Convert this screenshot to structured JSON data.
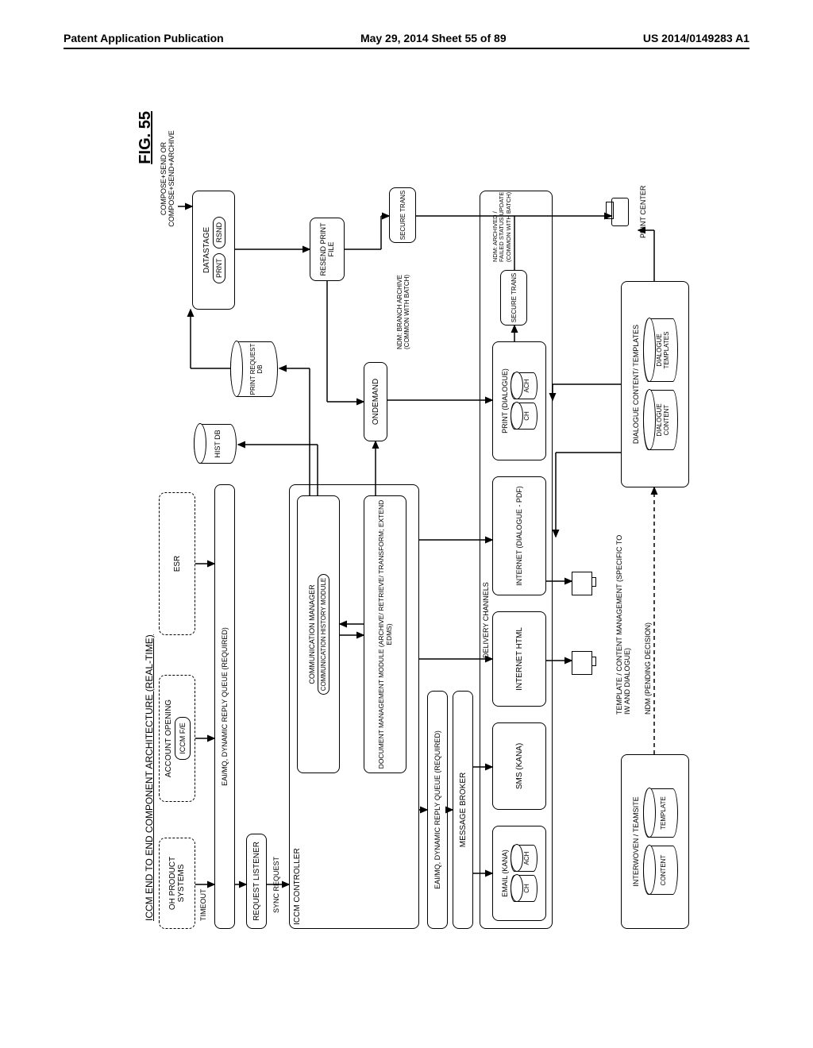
{
  "header": {
    "left": "Patent Application Publication",
    "center": "May 29, 2014  Sheet 55 of 89",
    "right": "US 2014/0149283 A1"
  },
  "figure": {
    "label": "FIG. 55",
    "title": "ICCM END TO END COMPONENT ARCHITECTURE (REAL-TIME)",
    "compose_note": "COMPOSE+SEND OR COMPOSE+SEND+ARCHIVE"
  },
  "boxes": {
    "oh_product_systems": "OH PRODUCT SYSTEMS",
    "account_opening": "ACCOUNT OPENING",
    "iccm_fe": "ICCM F/E",
    "esr": "ESR",
    "timeout": "TIMEOUT",
    "eai_mq_1": "EAI/MQ, DYNAMIC REPLY QUEUE (REQUIRED)",
    "request_listener": "REQUEST LISTENER",
    "sync_request": "SYNC REQUEST",
    "iccm_controller": "ICCM CONTROLLER",
    "comm_manager": "COMMUNICATION MANAGER",
    "comm_history": "COMMUNICATION HISTORY MODULE",
    "hist_db": "HIST DB",
    "print_request_db": "PRINT REQUEST DB",
    "datastage": "DATASTAGE",
    "prnt": "PRNT",
    "rsnd": "RSND",
    "doc_mgmt": "DOCUMENT MANAGEMENT MODULE (ARCHIVE/ RETRIEVE/ TRANSFORM; EXTEND EDMS)",
    "ondemand": "ONDEMAND",
    "resend_print": "RESEND PRINT FILE",
    "eai_mq_2": "EAI/MQ, DYNAMIC REPLY QUEUE (REQUIRED)",
    "message_broker": "MESSAGE BROKER",
    "delivery_channels": "DELIVERY CHANNELS",
    "email_kana": "EMAIL (KANA)",
    "sms_kana": "SMS (KANA)",
    "internet_html": "INTERNET HTML",
    "internet_pdf": "INTERNET (DIALOGUE - PDF)",
    "print_dialogue": "PRINT (DIALOGUE)",
    "ch1": "CH",
    "ach1": "ACH",
    "ch2": "CH",
    "ach2": "ACH",
    "secure_trans_1": "SECURE TRANS",
    "secure_trans_2": "SECURE TRANS",
    "ndm_branch": "NDM: BRANCH ARCHIVE (COMMON WITH BATCH)",
    "ndm_archived": "NDM: ARCHIVED / FAILED STATUS UPDATE (COMMON WITH BATCH)",
    "interwoven": "INTERWOVEN / TEAMSITE",
    "content": "CONTENT",
    "template": "TEMPLATE",
    "template_content_mgmt": "TEMPLATE / CONTENT MANAGEMENT (SPECIFIC TO IW AND DIALOGUE)",
    "ndm_pending": "NDM (PENDING DECISION)",
    "dialogue_ct": "DIALOGUE CONTENT/ TEMPLATES",
    "dialogue_content": "DIALOGUE CONTENT",
    "dialogue_templates": "DIALOGUE TEMPLATES",
    "print_center": "PRINT CENTER"
  }
}
